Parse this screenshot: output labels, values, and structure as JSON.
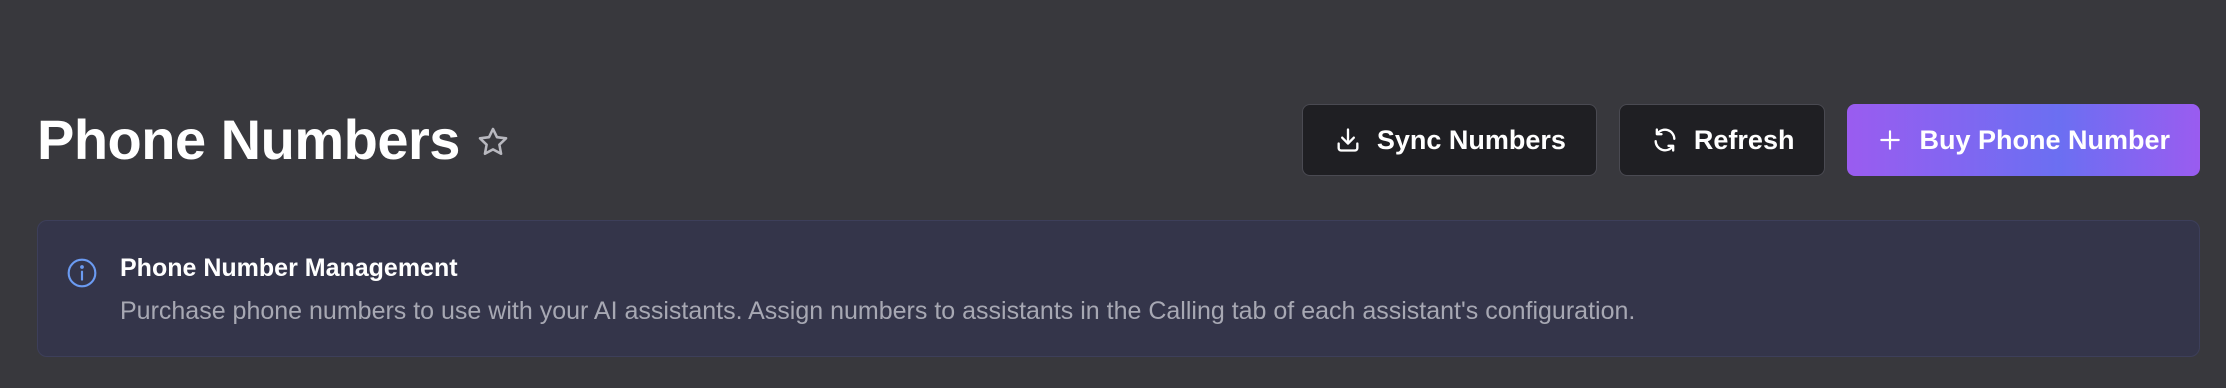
{
  "header": {
    "title": "Phone Numbers",
    "favorite_icon": "star-icon"
  },
  "actions": {
    "sync": {
      "label": "Sync Numbers",
      "icon": "download-icon"
    },
    "refresh": {
      "label": "Refresh",
      "icon": "refresh-icon"
    },
    "buy": {
      "label": "Buy Phone Number",
      "icon": "plus-icon"
    }
  },
  "info_banner": {
    "icon": "info-icon",
    "title": "Phone Number Management",
    "description": "Purchase phone numbers to use with your AI assistants. Assign numbers to assistants in the Calling tab of each assistant's configuration."
  },
  "colors": {
    "background": "#38383d",
    "primary_gradient_start": "#9a5cf0",
    "primary_gradient_mid": "#6b6ff2",
    "info_accent": "#6b9bf2",
    "banner_background": "#34354a"
  }
}
